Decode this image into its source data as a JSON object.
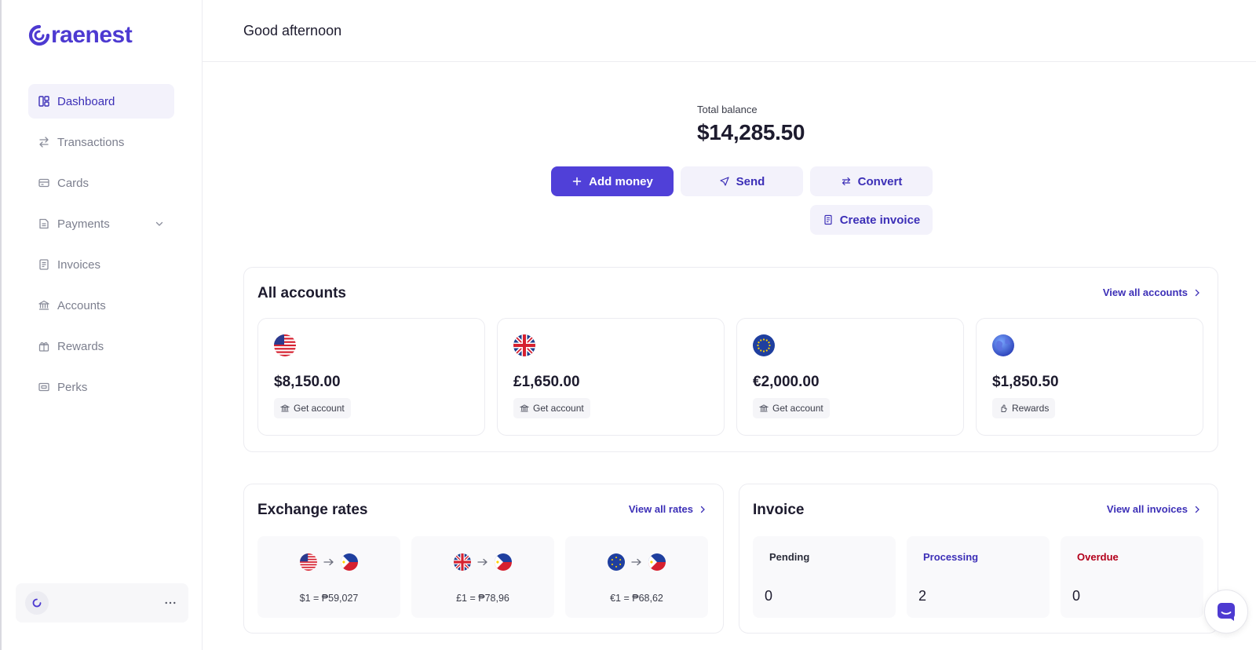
{
  "brand": {
    "name": "raenest",
    "color": "#4d3ad1"
  },
  "sidebar": {
    "items": [
      {
        "label": "Dashboard",
        "icon": "dashboard-icon",
        "active": true
      },
      {
        "label": "Transactions",
        "icon": "arrows-icon"
      },
      {
        "label": "Cards",
        "icon": "card-icon"
      },
      {
        "label": "Payments",
        "icon": "payments-icon",
        "expandable": true
      },
      {
        "label": "Invoices",
        "icon": "document-icon"
      },
      {
        "label": "Accounts",
        "icon": "bank-icon"
      },
      {
        "label": "Rewards",
        "icon": "gift-icon"
      },
      {
        "label": "Perks",
        "icon": "ticket-icon"
      }
    ]
  },
  "header": {
    "greeting": "Good afternoon"
  },
  "balance": {
    "label": "Total balance",
    "value": "$14,285.50"
  },
  "actions": {
    "add_money": "Add money",
    "send": "Send",
    "convert": "Convert",
    "create_invoice": "Create invoice"
  },
  "accounts": {
    "title": "All accounts",
    "link": "View all accounts",
    "items": [
      {
        "flag": "us-flag-icon",
        "amount": "$8,150.00",
        "action": "Get account"
      },
      {
        "flag": "uk-flag-icon",
        "amount": "£1,650.00",
        "action": "Get account"
      },
      {
        "flag": "eu-flag-icon",
        "amount": "€2,000.00",
        "action": "Get account"
      },
      {
        "flag": "globe-icon",
        "amount": "$1,850.50",
        "action": "Rewards"
      }
    ]
  },
  "exchange": {
    "title": "Exchange rates",
    "link": "View all rates",
    "items": [
      {
        "from": "us-flag-icon",
        "to": "ph-flag-icon",
        "text": "$1 = ₱59,027"
      },
      {
        "from": "uk-flag-icon",
        "to": "ph-flag-icon",
        "text": "£1 = ₱78,96"
      },
      {
        "from": "eu-flag-icon",
        "to": "ph-flag-icon",
        "text": "€1 = ₱68,62"
      }
    ]
  },
  "invoice": {
    "title": "Invoice",
    "link": "View all invoices",
    "items": [
      {
        "label": "Pending",
        "count": "0",
        "color": "#2b2d3a"
      },
      {
        "label": "Processing",
        "count": "2",
        "color": "#3c2fb7"
      },
      {
        "label": "Overdue",
        "count": "0",
        "color": "#b3001b"
      }
    ]
  }
}
